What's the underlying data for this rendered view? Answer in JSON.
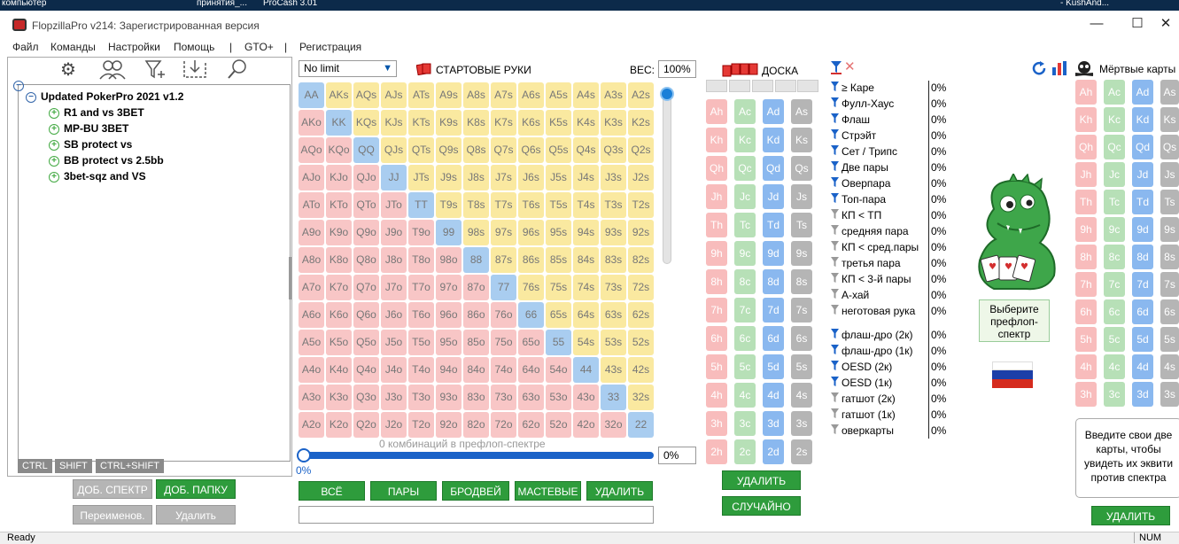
{
  "taskbar": {
    "left": "компьютер",
    "mid1": "принятия_...",
    "mid2": "ProCash 3.01",
    "right": "- KushAnd..."
  },
  "window": {
    "title": "FlopzillaPro v214: Зарегистрированная версия",
    "min": "—",
    "max": "☐",
    "close": "✕"
  },
  "menu": {
    "file": "Файл",
    "commands": "Команды",
    "settings": "Настройки",
    "help": "Помощь",
    "sep1": "|",
    "gto": "GTO+",
    "sep2": "|",
    "register": "Регистрация"
  },
  "tree": {
    "root": "Updated PokerPro 2021 v1.2",
    "children": [
      "R1 and vs 3BET",
      "MP-BU 3BET",
      "SB protect vs",
      "BB protect vs 2.5bb",
      "3bet-sqz and VS"
    ]
  },
  "keys": {
    "ctrl": "CTRL",
    "shift": "SHIFT",
    "ctrlshift": "CTRL+SHIFT"
  },
  "leftButtons": {
    "addSpectrum": "ДОБ. СПЕКТР",
    "addFolder": "ДОБ. ПАПКУ",
    "rename": "Переименов.",
    "delete": "Удалить"
  },
  "ranges": {
    "mode": "No limit",
    "startingHands": "СТАРТОВЫЕ РУКИ",
    "weightLabel": "ВЕС:",
    "weight": "100%",
    "combos": "0 комбинаций в префлоп-спектре",
    "sliderPct": "0%",
    "sliderBox": "0%",
    "ranks": [
      "A",
      "K",
      "Q",
      "J",
      "T",
      "9",
      "8",
      "7",
      "6",
      "5",
      "4",
      "3",
      "2"
    ]
  },
  "rangeButtons": {
    "all": "ВСЁ",
    "pairs": "ПАРЫ",
    "broadway": "БРОДВЕЙ",
    "suited": "МАСТЕВЫЕ",
    "delete": "УДАЛИТЬ"
  },
  "board": {
    "title": "ДОСКА",
    "delete": "УДАЛИТЬ",
    "random": "СЛУЧАЙНО",
    "suits": [
      "h",
      "c",
      "d",
      "s"
    ]
  },
  "stats": {
    "made": [
      {
        "label": "≥ Каре",
        "value": "0%",
        "filter": "blue"
      },
      {
        "label": "Фулл-Хаус",
        "value": "0%",
        "filter": "blue"
      },
      {
        "label": "Флаш",
        "value": "0%",
        "filter": "blue"
      },
      {
        "label": "Стрэйт",
        "value": "0%",
        "filter": "blue"
      },
      {
        "label": "Сет / Трипс",
        "value": "0%",
        "filter": "blue"
      },
      {
        "label": "Две пары",
        "value": "0%",
        "filter": "blue"
      },
      {
        "label": "Оверпара",
        "value": "0%",
        "filter": "blue"
      },
      {
        "label": "Топ-пара",
        "value": "0%",
        "filter": "blue"
      },
      {
        "label": "КП < ТП",
        "value": "0%",
        "filter": "gray"
      },
      {
        "label": "средняя пара",
        "value": "0%",
        "filter": "gray"
      },
      {
        "label": "КП < сред.пары",
        "value": "0%",
        "filter": "gray"
      },
      {
        "label": "третья пара",
        "value": "0%",
        "filter": "gray"
      },
      {
        "label": "КП < 3-й пары",
        "value": "0%",
        "filter": "gray"
      },
      {
        "label": "А-хай",
        "value": "0%",
        "filter": "gray"
      },
      {
        "label": "неготовая рука",
        "value": "0%",
        "filter": "gray"
      }
    ],
    "draws": [
      {
        "label": "флаш-дро (2к)",
        "value": "0%",
        "filter": "blue"
      },
      {
        "label": "флаш-дро (1к)",
        "value": "0%",
        "filter": "blue"
      },
      {
        "label": "OESD (2к)",
        "value": "0%",
        "filter": "blue"
      },
      {
        "label": "OESD (1к)",
        "value": "0%",
        "filter": "blue"
      },
      {
        "label": "гатшот (2к)",
        "value": "0%",
        "filter": "gray"
      },
      {
        "label": "гатшот (1к)",
        "value": "0%",
        "filter": "gray"
      },
      {
        "label": "оверкарты",
        "value": "0%",
        "filter": "gray"
      }
    ]
  },
  "mascot": {
    "hint": "Выберите префлоп-спектр"
  },
  "dead": {
    "title": "Мёртвые карты",
    "info": "Введите свои две карты, чтобы увидеть их эквити против спектра",
    "delete": "УДАЛИТЬ"
  },
  "status": {
    "left": "Ready",
    "right": "NUM"
  },
  "colors": {
    "green": "#2e9c3c",
    "blue": "#1a62c8",
    "pair": "#a9cdf0",
    "suited": "#fae9a0",
    "offsuit": "#f8c6c6"
  }
}
